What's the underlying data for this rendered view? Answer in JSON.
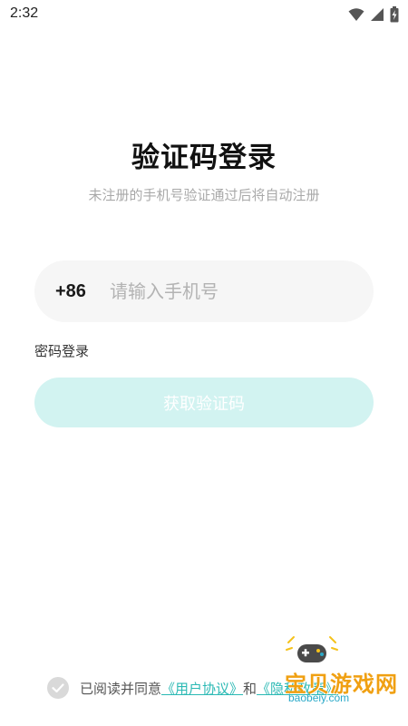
{
  "status_bar": {
    "time": "2:32",
    "icons": [
      "wifi-icon",
      "signal-icon",
      "battery-icon"
    ]
  },
  "login": {
    "title": "验证码登录",
    "subtitle": "未注册的手机号验证通过后将自动注册",
    "country_code": "+86",
    "phone_placeholder": "请输入手机号",
    "phone_value": "",
    "password_login": "密码登录",
    "get_code_label": "获取验证码"
  },
  "agreement": {
    "prefix": "已阅读并同意",
    "user_agreement": "《用户协议》",
    "and": "和",
    "privacy_policy": "《隐私政策》",
    "checked": false
  },
  "watermark": {
    "title": "宝贝游戏网",
    "url": "baobeiy.com"
  },
  "colors": {
    "accent": "#2bb9b4",
    "button_disabled_bg": "#d2f3f1",
    "input_bg": "#f6f6f6",
    "subtitle": "#a9a9a9"
  }
}
